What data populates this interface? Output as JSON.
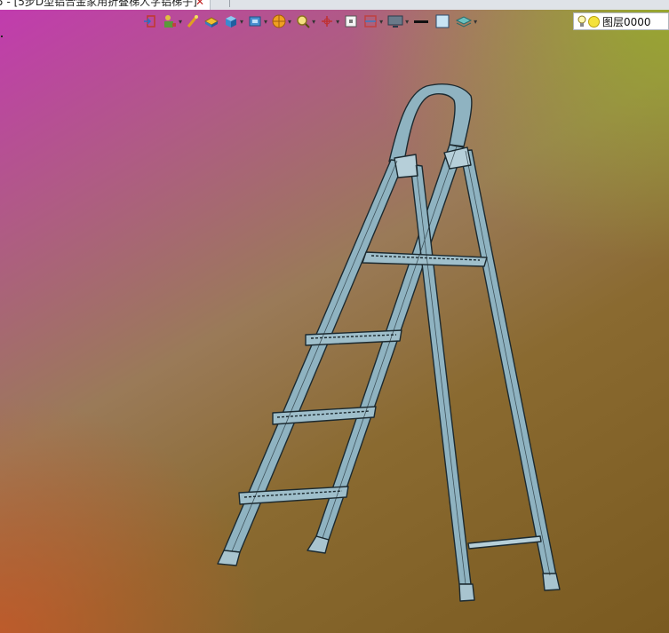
{
  "tab": {
    "title": "5 - [5步D型铝合金家用折叠梯人字铝梯子]",
    "close_icon": "close-icon"
  },
  "toolbar": {
    "buttons": [
      {
        "name": "exit-sketch",
        "icon": "exit-icon"
      },
      {
        "name": "insert-part",
        "icon": "insert-icon"
      },
      {
        "name": "brush",
        "icon": "brush-icon"
      },
      {
        "name": "material",
        "icon": "material-icon"
      },
      {
        "name": "cube",
        "icon": "cube-icon"
      },
      {
        "name": "view-cube",
        "icon": "view-cube-icon"
      },
      {
        "name": "render",
        "icon": "render-icon"
      },
      {
        "name": "zoom",
        "icon": "zoom-icon"
      },
      {
        "name": "coordinate",
        "icon": "axis-icon"
      },
      {
        "name": "frame",
        "icon": "frame-icon"
      },
      {
        "name": "section",
        "icon": "section-icon"
      },
      {
        "name": "display",
        "icon": "display-icon"
      },
      {
        "name": "line-style",
        "icon": "line-icon"
      },
      {
        "name": "color",
        "icon": "color-swatch-icon"
      },
      {
        "name": "layers",
        "icon": "layers-icon"
      }
    ]
  },
  "layer": {
    "label": "图层0000",
    "bulb_icon": "lightbulb-icon",
    "status_icon": "sun-icon"
  },
  "colors": {
    "ladder_fill": "#8fb3c1",
    "ladder_stroke": "#1c2a30",
    "accent_close": "#c02020"
  }
}
